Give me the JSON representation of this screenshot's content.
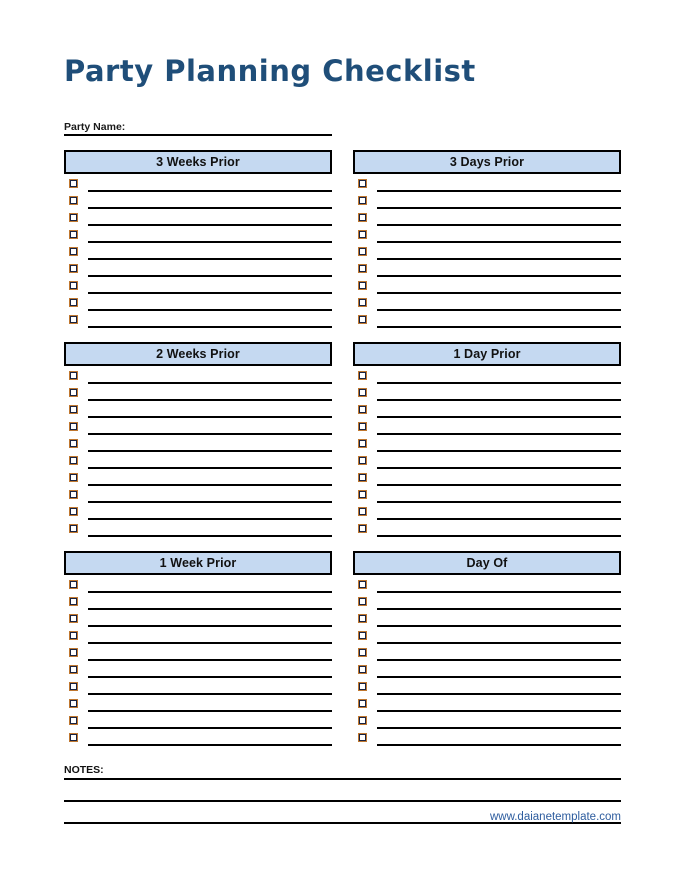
{
  "document": {
    "title": "Party Planning Checklist",
    "title_color": "#1f4e79",
    "header_fill": "#c5d9f1"
  },
  "party_name": {
    "label": "Party Name:",
    "value": ""
  },
  "sections": [
    {
      "id": "three-weeks-prior",
      "title": "3 Weeks Prior",
      "column": "left",
      "rows": 9
    },
    {
      "id": "three-days-prior",
      "title": "3 Days Prior",
      "column": "right",
      "rows": 9
    },
    {
      "id": "two-weeks-prior",
      "title": "2 Weeks Prior",
      "column": "left",
      "rows": 10
    },
    {
      "id": "one-day-prior",
      "title": "1 Day Prior",
      "column": "right",
      "rows": 10
    },
    {
      "id": "one-week-prior",
      "title": "1 Week Prior",
      "column": "left",
      "rows": 10
    },
    {
      "id": "day-of",
      "title": "Day Of",
      "column": "right",
      "rows": 10
    }
  ],
  "notes": {
    "label": "NOTES:",
    "lines": 2
  },
  "footer": {
    "website": "www.daianetemplate.com"
  }
}
